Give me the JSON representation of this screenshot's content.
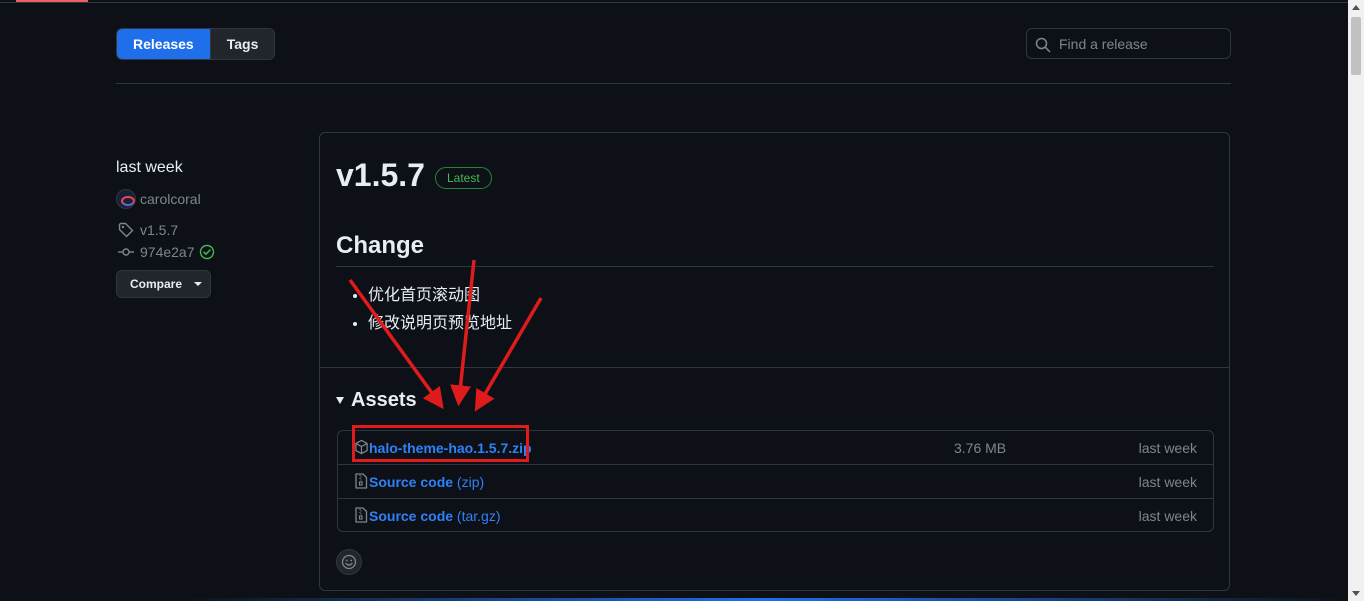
{
  "subnav": {
    "tabs": [
      {
        "label": "Releases",
        "active": true
      },
      {
        "label": "Tags",
        "active": false
      }
    ],
    "search_placeholder": "Find a release"
  },
  "meta": {
    "date": "last week",
    "author": "carolcoral",
    "tag": "v1.5.7",
    "commit": "974e2a7",
    "compare_label": "Compare"
  },
  "release": {
    "title": "v1.5.7",
    "badge": "Latest",
    "notes_heading": "Change",
    "notes": [
      "优化首页滚动图",
      "修改说明页预览地址"
    ],
    "assets_heading": "Assets",
    "assets": [
      {
        "name": "halo-theme-hao.1.5.7.zip",
        "ext": "",
        "size": "3.76 MB",
        "time": "last week",
        "icon": "package-icon"
      },
      {
        "name": "Source code",
        "ext": " (zip)",
        "size": "",
        "time": "last week",
        "icon": "file-zip-icon"
      },
      {
        "name": "Source code",
        "ext": " (tar.gz)",
        "size": "",
        "time": "last week",
        "icon": "file-zip-icon"
      }
    ]
  },
  "colors": {
    "background": "#0d1117",
    "accent_blue": "#1f6feb",
    "link": "#2f81f7",
    "success": "#3fb950",
    "annotation_red": "#e01b1b"
  }
}
